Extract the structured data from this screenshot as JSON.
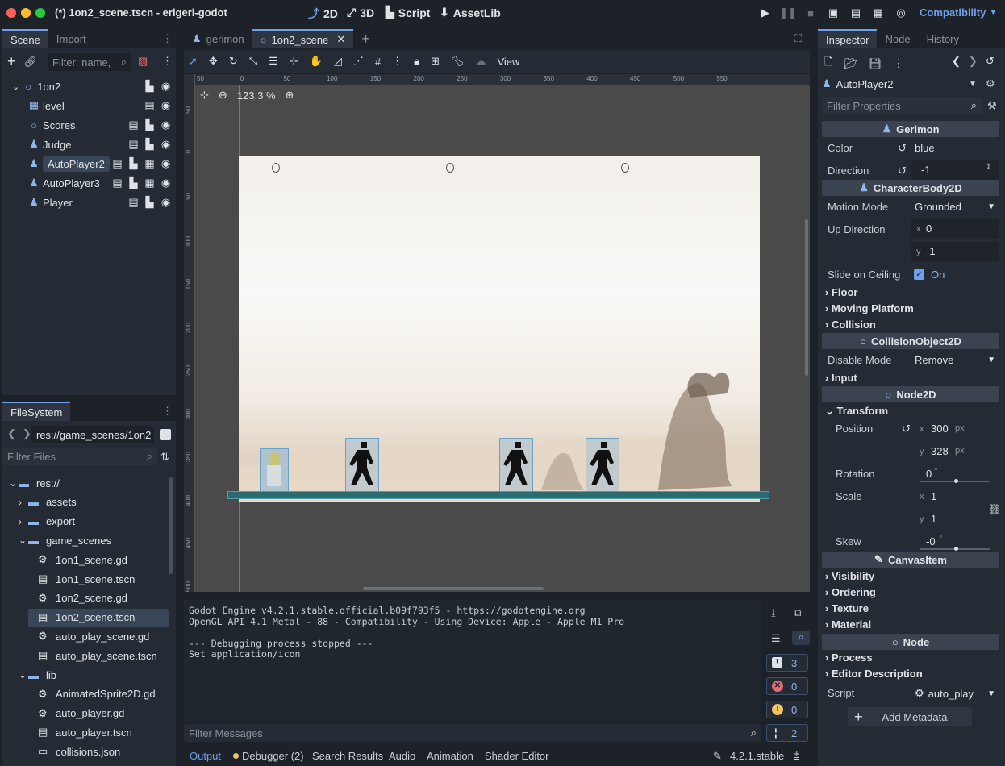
{
  "window": {
    "title": "(*) 1on2_scene.tscn - erigeri-godot",
    "modes": [
      "2D",
      "3D",
      "Script",
      "AssetLib"
    ],
    "renderer": "Compatibility"
  },
  "scene_dock": {
    "tabs": [
      "Scene",
      "Import"
    ],
    "filter_placeholder": "Filter: name,",
    "nodes": [
      {
        "label": "1on2",
        "icon": "node2d-circle-icon"
      },
      {
        "label": "level",
        "icon": "tilemap-icon"
      },
      {
        "label": "Scores",
        "icon": "node2d-circle-icon"
      },
      {
        "label": "Judge",
        "icon": "character-body-icon"
      },
      {
        "label": "AutoPlayer2",
        "icon": "character-body-icon"
      },
      {
        "label": "AutoPlayer3",
        "icon": "character-body-icon"
      },
      {
        "label": "Player",
        "icon": "character-body-icon"
      }
    ]
  },
  "filesystem": {
    "title": "FileSystem",
    "path": "res://game_scenes/1on2",
    "filter_placeholder": "Filter Files",
    "items": [
      {
        "label": "res://",
        "type": "folder"
      },
      {
        "label": "assets",
        "type": "folder"
      },
      {
        "label": "export",
        "type": "folder"
      },
      {
        "label": "game_scenes",
        "type": "folder"
      },
      {
        "label": "1on1_scene.gd",
        "type": "script"
      },
      {
        "label": "1on1_scene.tscn",
        "type": "scene"
      },
      {
        "label": "1on2_scene.gd",
        "type": "script"
      },
      {
        "label": "1on2_scene.tscn",
        "type": "scene"
      },
      {
        "label": "auto_play_scene.gd",
        "type": "script"
      },
      {
        "label": "auto_play_scene.tscn",
        "type": "scene"
      },
      {
        "label": "lib",
        "type": "folder"
      },
      {
        "label": "AnimatedSprite2D.gd",
        "type": "script"
      },
      {
        "label": "auto_player.gd",
        "type": "script"
      },
      {
        "label": "auto_player.tscn",
        "type": "scene"
      },
      {
        "label": "collisions.json",
        "type": "file"
      }
    ]
  },
  "editor_tabs": [
    "gerimon",
    "1on2_scene"
  ],
  "toolbar": {
    "view_label": "View"
  },
  "viewport": {
    "zoom": "123.3 %",
    "ruler_top": [
      "50",
      "0",
      "50",
      "100",
      "150",
      "200",
      "250",
      "300",
      "350",
      "400",
      "450",
      "500",
      "550"
    ],
    "ruler_left": [
      "50",
      "0",
      "50",
      "100",
      "150",
      "200",
      "250",
      "300",
      "350",
      "400",
      "450",
      "500"
    ]
  },
  "output": {
    "lines": [
      "Godot Engine v4.2.1.stable.official.b09f793f5 - https://godotengine.org",
      "OpenGL API 4.1 Metal - 88 - Compatibility - Using Device: Apple - Apple M1 Pro",
      "",
      "--- Debugging process stopped ---",
      "Set application/icon"
    ],
    "filter_placeholder": "Filter Messages",
    "counts": {
      "messages": "3",
      "errors": "0",
      "warnings": "0",
      "info": "2"
    }
  },
  "bottom_tabs": [
    "Output",
    "Debugger (2)",
    "Search Results",
    "Audio",
    "Animation",
    "Shader Editor"
  ],
  "version": "4.2.1.stable",
  "inspector": {
    "tabs": [
      "Inspector",
      "Node",
      "History"
    ],
    "selected": "AutoPlayer2",
    "filter_placeholder": "Filter Properties",
    "gerimon": "Gerimon",
    "color_label": "Color",
    "color_value": "blue",
    "direction_label": "Direction",
    "direction_value": "-1",
    "characterbody": "CharacterBody2D",
    "motion_mode_label": "Motion Mode",
    "motion_mode_value": "Grounded",
    "up_direction_label": "Up Direction",
    "up_x": "0",
    "up_y": "-1",
    "slide_label": "Slide on Ceiling",
    "slide_value": "On",
    "floor": "Floor",
    "moving_platform": "Moving Platform",
    "collision": "Collision",
    "collisionobject": "CollisionObject2D",
    "disable_mode_label": "Disable Mode",
    "disable_mode_value": "Remove",
    "input": "Input",
    "node2d": "Node2D",
    "transform": "Transform",
    "position_label": "Position",
    "pos_x": "300",
    "pos_y": "328",
    "px": "px",
    "rotation_label": "Rotation",
    "rotation_value": "0",
    "scale_label": "Scale",
    "scale_x": "1",
    "scale_y": "1",
    "skew_label": "Skew",
    "skew_value": "-0",
    "canvasitem": "CanvasItem",
    "visibility": "Visibility",
    "ordering": "Ordering",
    "texture": "Texture",
    "material": "Material",
    "node": "Node",
    "process": "Process",
    "editor_description": "Editor Description",
    "script_label": "Script",
    "script_value": "auto_play",
    "add_metadata": "Add Metadata"
  }
}
